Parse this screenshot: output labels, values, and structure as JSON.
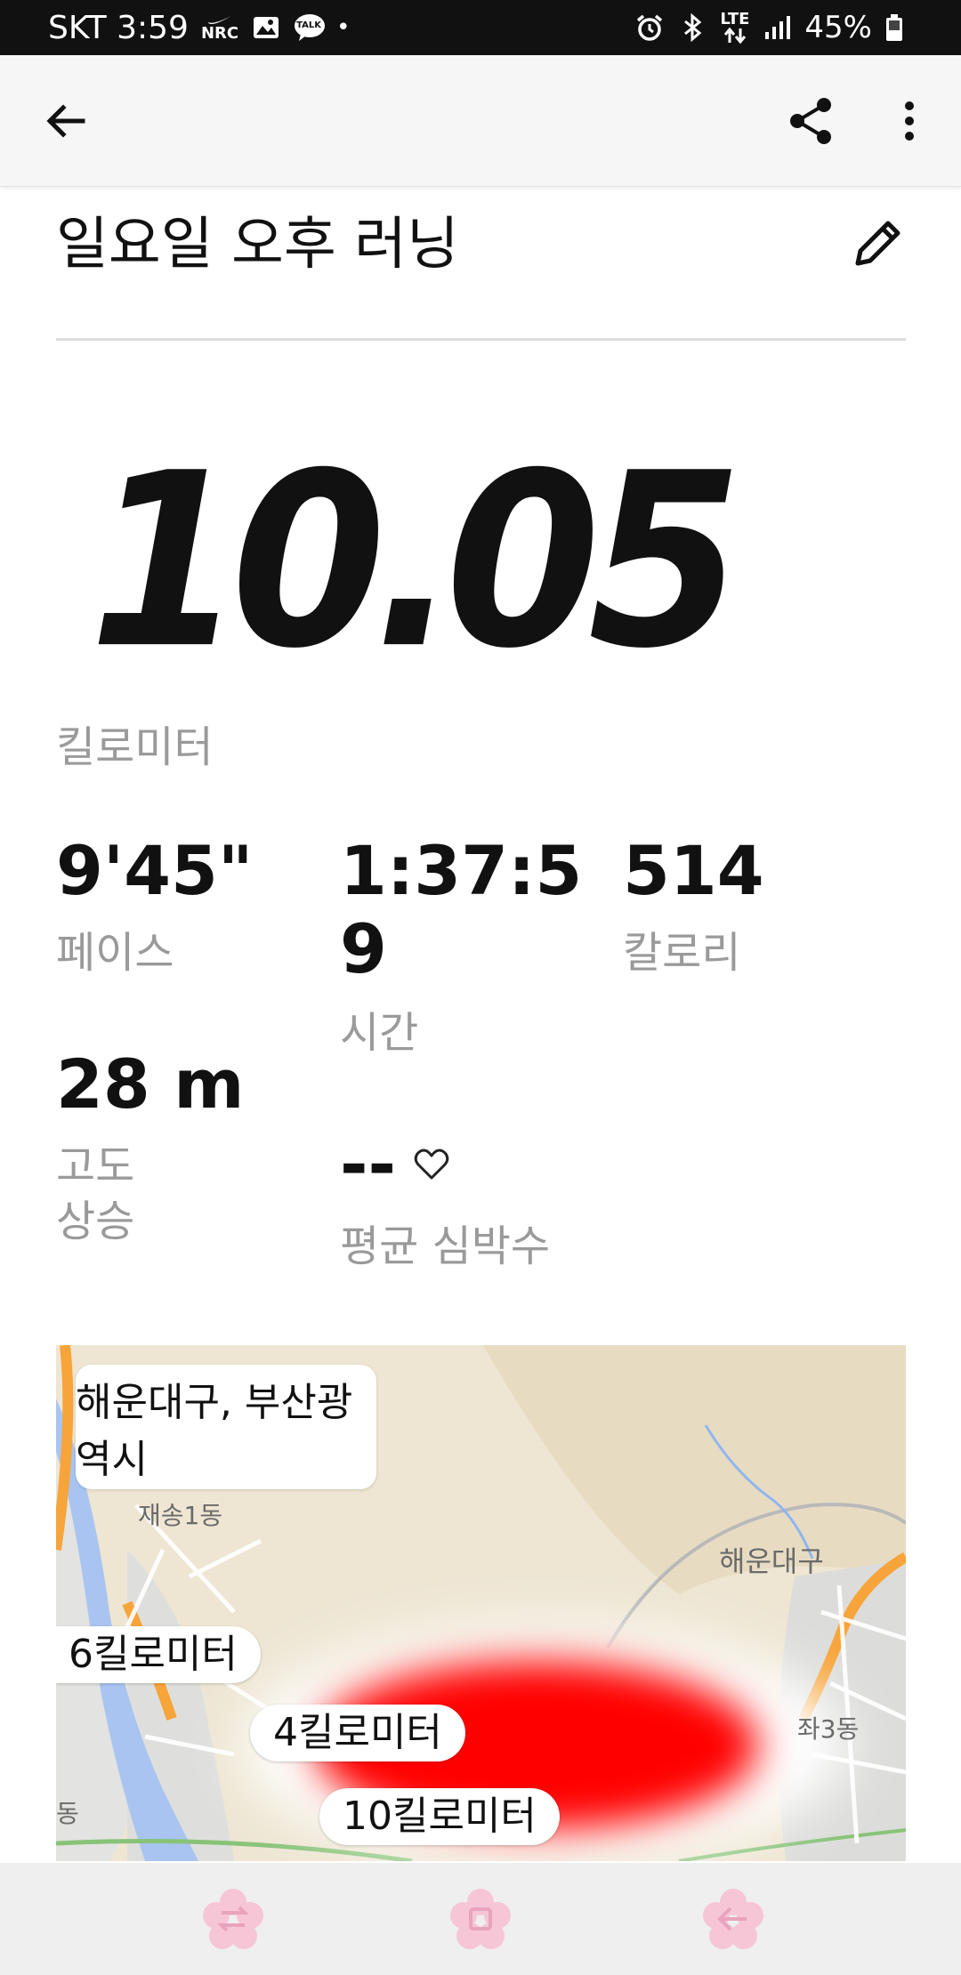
{
  "status_bar": {
    "carrier_time": "SKT 3:59",
    "nrc_badge": "NRC",
    "talk_badge": "TALK",
    "dot": "•",
    "network": "LTE",
    "battery": "45%",
    "icons": [
      "nike-icon",
      "gallery-icon",
      "kakaotalk-icon",
      "alarm-icon",
      "bluetooth-icon",
      "data-arrows-icon",
      "signal-icon",
      "battery-icon"
    ]
  },
  "appbar": {
    "icons": [
      "back-arrow-icon",
      "share-icon",
      "more-vert-icon"
    ]
  },
  "activity": {
    "title": "일요일 오후 러닝",
    "distance": "10.05",
    "distance_unit": "킬로미터"
  },
  "stats": {
    "pace": {
      "value": "9'45\"",
      "label": "페이스"
    },
    "time": {
      "value_line1": "1:37:5",
      "value_line2": "9",
      "label": "시간"
    },
    "calories": {
      "value": "514",
      "label": "칼로리"
    },
    "elevation": {
      "value": "28 m",
      "label_line1": "고도",
      "label_line2": "상승"
    },
    "heart_rate": {
      "value": "--",
      "label": "평균 심박수"
    }
  },
  "map": {
    "location": "해운대구, 부산광역시",
    "place_labels": [
      "재송1동",
      "해운대구",
      "좌3동",
      "동"
    ],
    "km_markers": [
      "6킬로미터",
      "4킬로미터",
      "10킬로미터"
    ],
    "colors": {
      "route_blob": "#ff0000",
      "road": "#f7a43a",
      "water": "#a9c4f0"
    }
  },
  "navbar": {
    "icons": [
      "recent-apps-icon",
      "home-icon",
      "back-icon"
    ]
  }
}
